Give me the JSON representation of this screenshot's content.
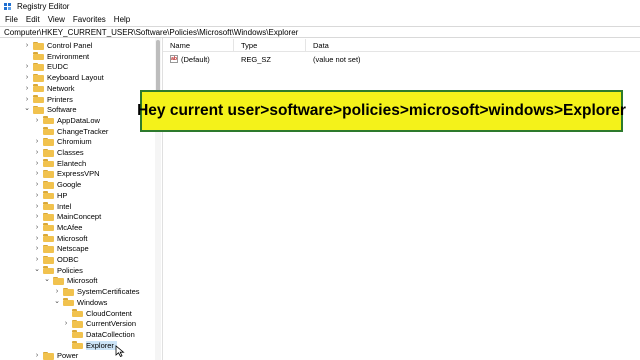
{
  "window": {
    "title": "Registry Editor",
    "icon": "registry-editor-icon"
  },
  "menu": [
    "File",
    "Edit",
    "View",
    "Favorites",
    "Help"
  ],
  "address": "Computer\\HKEY_CURRENT_USER\\Software\\Policies\\Microsoft\\Windows\\Explorer",
  "tree": [
    {
      "label": "Control Panel",
      "level": 2,
      "expander": "collapsed"
    },
    {
      "label": "Environment",
      "level": 2,
      "expander": "none"
    },
    {
      "label": "EUDC",
      "level": 2,
      "expander": "collapsed"
    },
    {
      "label": "Keyboard Layout",
      "level": 2,
      "expander": "collapsed"
    },
    {
      "label": "Network",
      "level": 2,
      "expander": "collapsed"
    },
    {
      "label": "Printers",
      "level": 2,
      "expander": "collapsed"
    },
    {
      "label": "Software",
      "level": 2,
      "expander": "expanded"
    },
    {
      "label": "AppDataLow",
      "level": 3,
      "expander": "collapsed"
    },
    {
      "label": "ChangeTracker",
      "level": 3,
      "expander": "none"
    },
    {
      "label": "Chromium",
      "level": 3,
      "expander": "collapsed"
    },
    {
      "label": "Classes",
      "level": 3,
      "expander": "collapsed"
    },
    {
      "label": "Elantech",
      "level": 3,
      "expander": "collapsed"
    },
    {
      "label": "ExpressVPN",
      "level": 3,
      "expander": "collapsed"
    },
    {
      "label": "Google",
      "level": 3,
      "expander": "collapsed"
    },
    {
      "label": "HP",
      "level": 3,
      "expander": "collapsed"
    },
    {
      "label": "Intel",
      "level": 3,
      "expander": "collapsed"
    },
    {
      "label": "MainConcept",
      "level": 3,
      "expander": "collapsed"
    },
    {
      "label": "McAfee",
      "level": 3,
      "expander": "collapsed"
    },
    {
      "label": "Microsoft",
      "level": 3,
      "expander": "collapsed"
    },
    {
      "label": "Netscape",
      "level": 3,
      "expander": "collapsed"
    },
    {
      "label": "ODBC",
      "level": 3,
      "expander": "collapsed"
    },
    {
      "label": "Policies",
      "level": 3,
      "expander": "expanded"
    },
    {
      "label": "Microsoft",
      "level": 4,
      "expander": "expanded"
    },
    {
      "label": "SystemCertificates",
      "level": 5,
      "expander": "collapsed"
    },
    {
      "label": "Windows",
      "level": 5,
      "expander": "expanded"
    },
    {
      "label": "CloudContent",
      "level": 6,
      "expander": "none"
    },
    {
      "label": "CurrentVersion",
      "level": 6,
      "expander": "collapsed"
    },
    {
      "label": "DataCollection",
      "level": 6,
      "expander": "none"
    },
    {
      "label": "Explorer",
      "level": 6,
      "expander": "none",
      "selected": true
    },
    {
      "label": "Power",
      "level": 3,
      "expander": "collapsed"
    }
  ],
  "list": {
    "columns": [
      "Name",
      "Type",
      "Data"
    ],
    "rows": [
      {
        "icon": "string-value-icon",
        "name": "(Default)",
        "type": "REG_SZ",
        "data": "(value not set)"
      }
    ]
  },
  "banner": {
    "text": "Hey current user>software>policies>microsoft>windows>Explorer",
    "background": "#f4f21a",
    "border": "#2d7a2d"
  },
  "colors": {
    "folder": "#f1c24e",
    "selection": "#cce4f7"
  }
}
